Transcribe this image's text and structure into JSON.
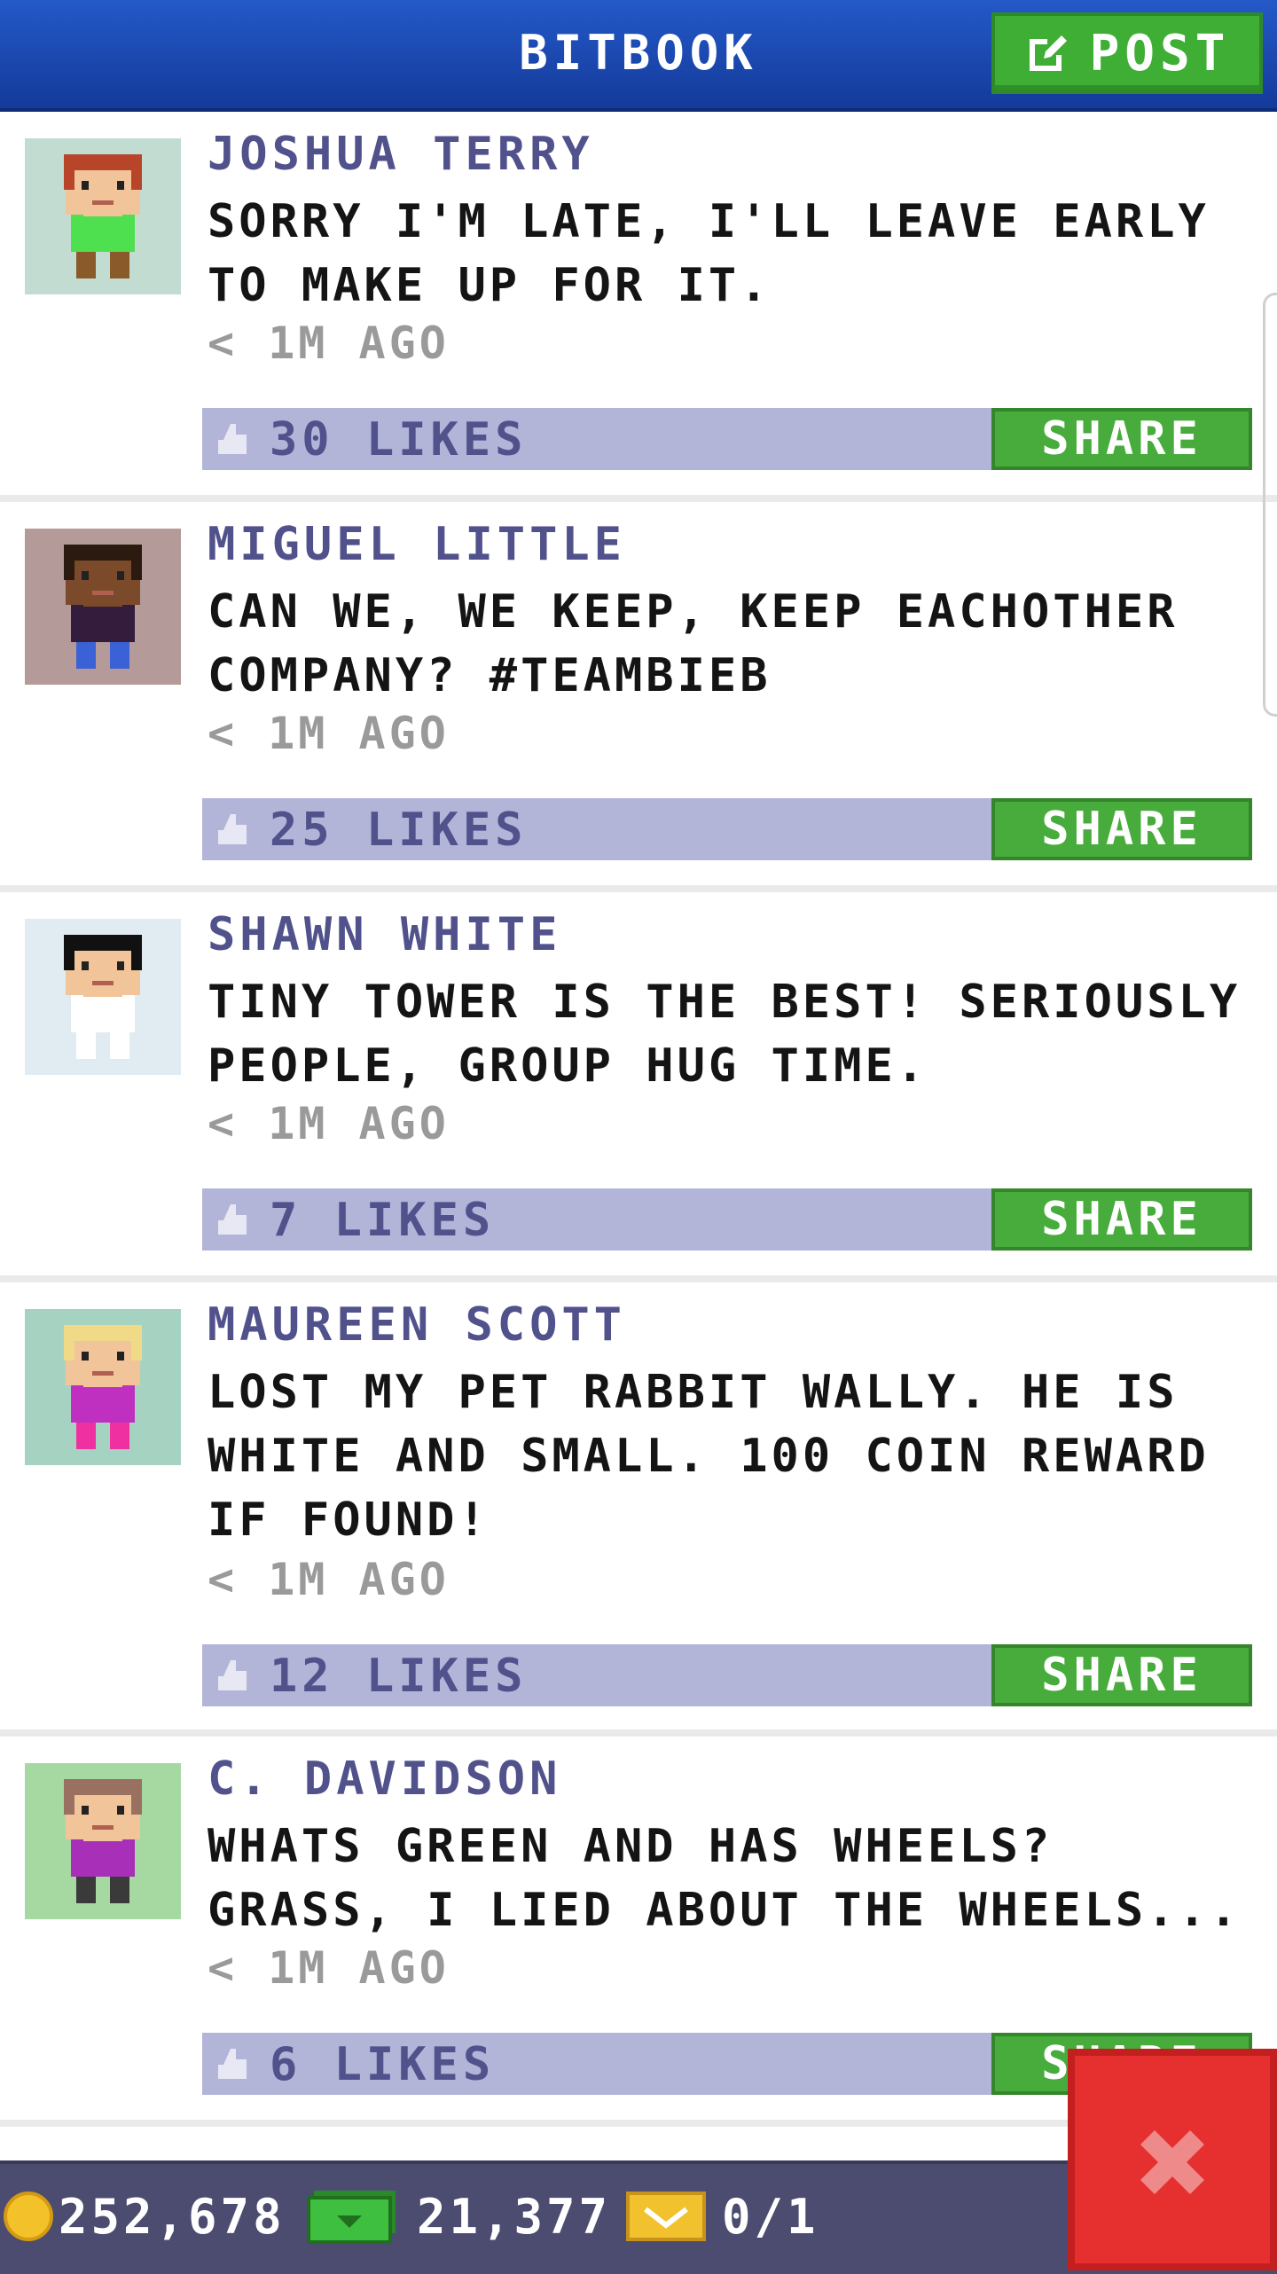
{
  "header": {
    "title": "BITBOOK",
    "post_label": "POST"
  },
  "posts": [
    {
      "author": "JOSHUA TERRY",
      "message": "SORRY I'M LATE, I'LL LEAVE EARLY TO MAKE UP FOR IT.",
      "time": "< 1M AGO",
      "likes": "30 LIKES",
      "share_label": "SHARE",
      "avatar_bg": "#c2dcd2",
      "skin": "#f2c49a",
      "hair": "#b8442a",
      "shirt": "#4fe04f",
      "pants": "#8a5a2a"
    },
    {
      "author": "MIGUEL LITTLE",
      "message": "CAN WE, WE KEEP, KEEP EACHOTHER COMPANY? #TEAMBIEB",
      "time": "< 1M AGO",
      "likes": "25 LIKES",
      "share_label": "SHARE",
      "avatar_bg": "#b49a98",
      "skin": "#7a4a2a",
      "hair": "#2a1a10",
      "shirt": "#341c3c",
      "pants": "#3a62d6"
    },
    {
      "author": "SHAWN WHITE",
      "message": "TINY TOWER IS THE BEST! SERIOUSLY PEOPLE, GROUP HUG TIME.",
      "time": "< 1M AGO",
      "likes": "7 LIKES",
      "share_label": "SHARE",
      "avatar_bg": "#e0ecf2",
      "skin": "#f2c49a",
      "hair": "#111111",
      "shirt": "#ffffff",
      "pants": "#ffffff"
    },
    {
      "author": "MAUREEN SCOTT",
      "message": "LOST MY PET RABBIT WALLY. HE IS WHITE AND SMALL. 100 COIN REWARD IF FOUND!",
      "time": "< 1M AGO",
      "likes": "12 LIKES",
      "share_label": "SHARE",
      "avatar_bg": "#a6d2c2",
      "skin": "#f2c49a",
      "hair": "#f0da88",
      "shirt": "#c030c0",
      "pants": "#ee30a0"
    },
    {
      "author": "C. DAVIDSON",
      "message": "WHATS GREEN AND HAS WHEELS? GRASS, I LIED ABOUT THE WHEELS...",
      "time": "< 1M AGO",
      "likes": "6 LIKES",
      "share_label": "SHARE",
      "avatar_bg": "#a6d8a2",
      "skin": "#f2c49a",
      "hair": "#9a7060",
      "shirt": "#a830b8",
      "pants": "#3a3a3a"
    }
  ],
  "status": {
    "coins": "252,678",
    "bux": "21,377",
    "tickets": "0/1"
  },
  "colors": {
    "header_blue": "#1e4fb8",
    "like_bar": "#b2b5d8",
    "share_green": "#47ac3b",
    "close_red": "#e63030"
  },
  "icons": [
    "edit-icon",
    "like-icon",
    "coin-icon",
    "cash-icon",
    "ticket-icon",
    "close-icon"
  ]
}
